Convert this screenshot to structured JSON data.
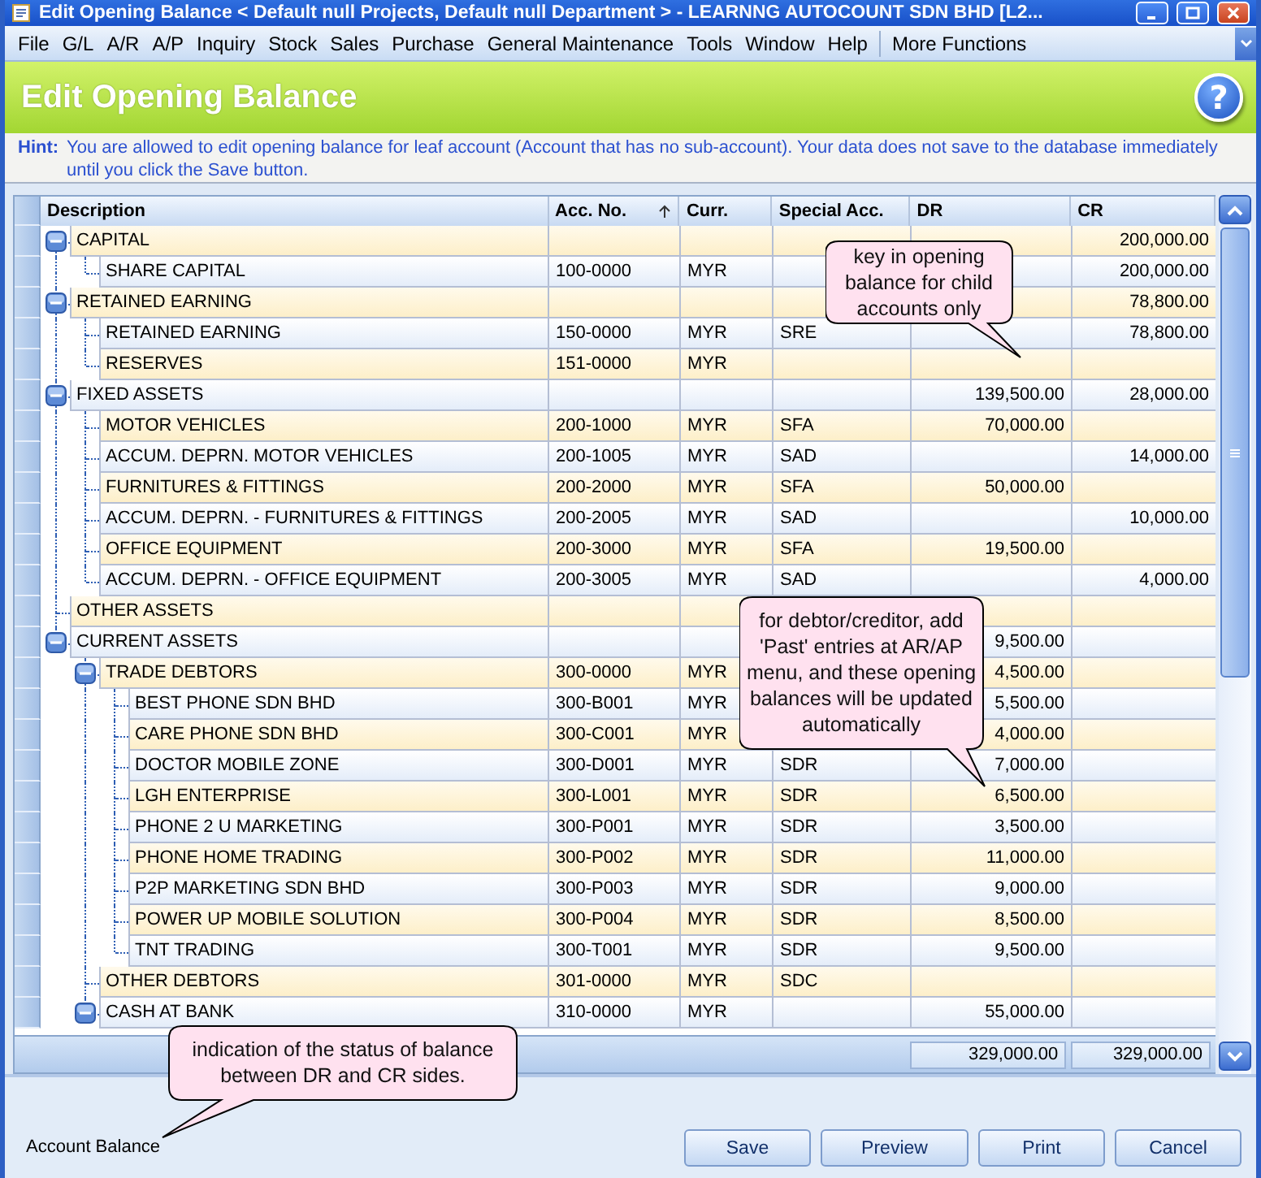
{
  "window": {
    "title": "Edit Opening Balance < Default null Projects, Default null Department > - LEARNNG AUTOCOUNT SDN BHD [L2..."
  },
  "menu": [
    "File",
    "G/L",
    "A/R",
    "A/P",
    "Inquiry",
    "Stock",
    "Sales",
    "Purchase",
    "General Maintenance",
    "Tools",
    "Window",
    "Help",
    "More Functions"
  ],
  "header": {
    "title": "Edit Opening Balance",
    "help": "?"
  },
  "hint": {
    "label": "Hint:",
    "text": "You are allowed to edit opening balance for leaf account (Account that has no sub-account). Your data does not save to the database immediately until you click the Save button."
  },
  "table": {
    "columns": [
      {
        "label": "Description"
      },
      {
        "label": "Acc. No.",
        "sorted": true
      },
      {
        "label": "Curr."
      },
      {
        "label": "Special Acc."
      },
      {
        "label": "DR"
      },
      {
        "label": "CR"
      }
    ],
    "rows": [
      {
        "description": "CAPITAL",
        "cr": "200,000.00",
        "expanded": true,
        "children": [
          {
            "description": "SHARE CAPITAL",
            "acc_no": "100-0000",
            "curr": "MYR",
            "cr": "200,000.00"
          }
        ]
      },
      {
        "description": "RETAINED EARNING",
        "cr": "78,800.00",
        "expanded": true,
        "children": [
          {
            "description": "RETAINED EARNING",
            "acc_no": "150-0000",
            "curr": "MYR",
            "special": "SRE",
            "cr": "78,800.00"
          },
          {
            "description": "RESERVES",
            "acc_no": "151-0000",
            "curr": "MYR"
          }
        ]
      },
      {
        "description": "FIXED ASSETS",
        "dr": "139,500.00",
        "cr": "28,000.00",
        "expanded": true,
        "children": [
          {
            "description": "MOTOR VEHICLES",
            "acc_no": "200-1000",
            "curr": "MYR",
            "special": "SFA",
            "dr": "70,000.00"
          },
          {
            "description": "ACCUM. DEPRN. MOTOR VEHICLES",
            "acc_no": "200-1005",
            "curr": "MYR",
            "special": "SAD",
            "cr": "14,000.00"
          },
          {
            "description": "FURNITURES & FITTINGS",
            "acc_no": "200-2000",
            "curr": "MYR",
            "special": "SFA",
            "dr": "50,000.00"
          },
          {
            "description": "ACCUM. DEPRN. - FURNITURES & FITTINGS",
            "acc_no": "200-2005",
            "curr": "MYR",
            "special": "SAD",
            "cr": "10,000.00"
          },
          {
            "description": "OFFICE EQUIPMENT",
            "acc_no": "200-3000",
            "curr": "MYR",
            "special": "SFA",
            "dr": "19,500.00"
          },
          {
            "description": "ACCUM. DEPRN. - OFFICE EQUIPMENT",
            "acc_no": "200-3005",
            "curr": "MYR",
            "special": "SAD",
            "cr": "4,000.00"
          }
        ]
      },
      {
        "description": "OTHER ASSETS"
      },
      {
        "description": "CURRENT ASSETS",
        "dr": "9,500.00",
        "expanded": true,
        "children": [
          {
            "description": "TRADE DEBTORS",
            "acc_no": "300-0000",
            "curr": "MYR",
            "dr": "4,500.00",
            "expanded": true,
            "children": [
              {
                "description": "BEST PHONE SDN BHD",
                "acc_no": "300-B001",
                "curr": "MYR",
                "dr": "5,500.00"
              },
              {
                "description": "CARE PHONE SDN BHD",
                "acc_no": "300-C001",
                "curr": "MYR",
                "dr": "4,000.00"
              },
              {
                "description": "DOCTOR MOBILE ZONE",
                "acc_no": "300-D001",
                "curr": "MYR",
                "special": "SDR",
                "dr": "7,000.00"
              },
              {
                "description": "LGH ENTERPRISE",
                "acc_no": "300-L001",
                "curr": "MYR",
                "special": "SDR",
                "dr": "6,500.00"
              },
              {
                "description": "PHONE 2 U MARKETING",
                "acc_no": "300-P001",
                "curr": "MYR",
                "special": "SDR",
                "dr": "3,500.00"
              },
              {
                "description": "PHONE HOME TRADING",
                "acc_no": "300-P002",
                "curr": "MYR",
                "special": "SDR",
                "dr": "11,000.00"
              },
              {
                "description": "P2P MARKETING SDN BHD",
                "acc_no": "300-P003",
                "curr": "MYR",
                "special": "SDR",
                "dr": "9,000.00"
              },
              {
                "description": "POWER UP MOBILE SOLUTION",
                "acc_no": "300-P004",
                "curr": "MYR",
                "special": "SDR",
                "dr": "8,500.00"
              },
              {
                "description": "TNT TRADING",
                "acc_no": "300-T001",
                "curr": "MYR",
                "special": "SDR",
                "dr": "9,500.00"
              }
            ]
          },
          {
            "description": "OTHER DEBTORS",
            "acc_no": "301-0000",
            "curr": "MYR",
            "special": "SDC"
          },
          {
            "description": "CASH AT BANK",
            "acc_no": "310-0000",
            "curr": "MYR",
            "dr": "55,000.00",
            "expanded": true
          }
        ]
      }
    ],
    "totals": {
      "dr": "329,000.00",
      "cr": "329,000.00"
    }
  },
  "account_balance_label": "Account Balance",
  "buttons": [
    "Save",
    "Preview",
    "Print",
    "Cancel"
  ],
  "callouts": [
    {
      "text": "key in opening balance for child accounts only"
    },
    {
      "text": "for debtor/creditor, add 'Past' entries at AR/AP menu, and these opening balances will be updated automatically"
    },
    {
      "text": "indication of the status of balance between DR and CR sides."
    }
  ]
}
